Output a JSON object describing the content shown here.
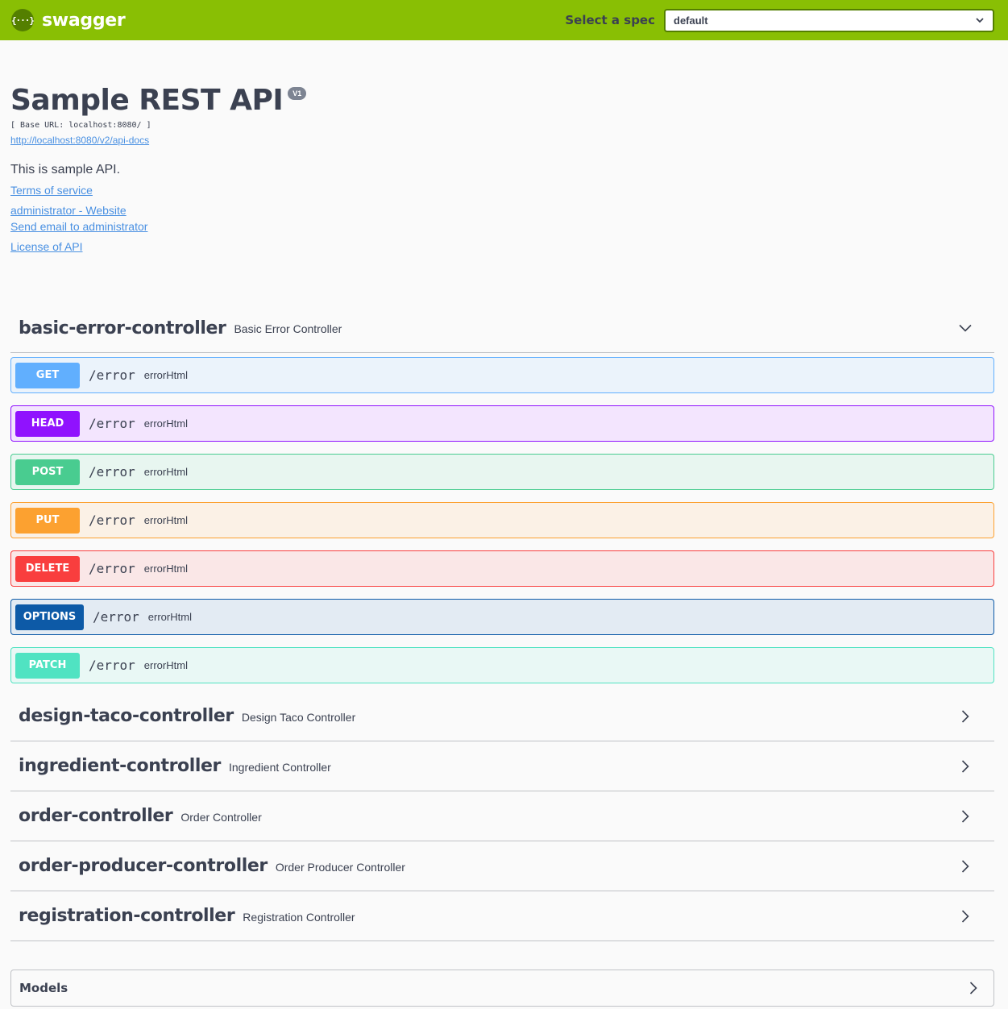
{
  "topbar": {
    "logo_mark": "{···}",
    "logo_text": "swagger",
    "spec_label": "Select a spec",
    "spec_value": "default",
    "brand_color": "#89bf04"
  },
  "info": {
    "title": "Sample REST API",
    "version": "V1",
    "base_url": "[ Base URL: localhost:8080/ ]",
    "docs_link": "http://localhost:8080/v2/api-docs",
    "description": "This is sample API.",
    "terms": "Terms of service",
    "website": "administrator - Website",
    "email": "Send email to administrator",
    "license": "License of API"
  },
  "controllers": [
    {
      "name": "basic-error-controller",
      "desc": "Basic Error Controller",
      "expanded": true
    },
    {
      "name": "design-taco-controller",
      "desc": "Design Taco Controller",
      "expanded": false
    },
    {
      "name": "ingredient-controller",
      "desc": "Ingredient Controller",
      "expanded": false
    },
    {
      "name": "order-controller",
      "desc": "Order Controller",
      "expanded": false
    },
    {
      "name": "order-producer-controller",
      "desc": "Order Producer Controller",
      "expanded": false
    },
    {
      "name": "registration-controller",
      "desc": "Registration Controller",
      "expanded": false
    }
  ],
  "operations": [
    {
      "method": "GET",
      "path": "/error",
      "summary": "errorHtml",
      "color": "#61affe",
      "bg": "#ebf3fb"
    },
    {
      "method": "HEAD",
      "path": "/error",
      "summary": "errorHtml",
      "color": "#9012fe",
      "bg": "#f3e5fe"
    },
    {
      "method": "POST",
      "path": "/error",
      "summary": "errorHtml",
      "color": "#49cc90",
      "bg": "#e8f6f0"
    },
    {
      "method": "PUT",
      "path": "/error",
      "summary": "errorHtml",
      "color": "#fca130",
      "bg": "#fbf1e6"
    },
    {
      "method": "DELETE",
      "path": "/error",
      "summary": "errorHtml",
      "color": "#f93e3e",
      "bg": "#fae7e7"
    },
    {
      "method": "OPTIONS",
      "path": "/error",
      "summary": "errorHtml",
      "color": "#0d5aa7",
      "bg": "#e3ebf3"
    },
    {
      "method": "PATCH",
      "path": "/error",
      "summary": "errorHtml",
      "color": "#50e3c2",
      "bg": "#e9f8f5"
    }
  ],
  "models": {
    "label": "Models"
  }
}
